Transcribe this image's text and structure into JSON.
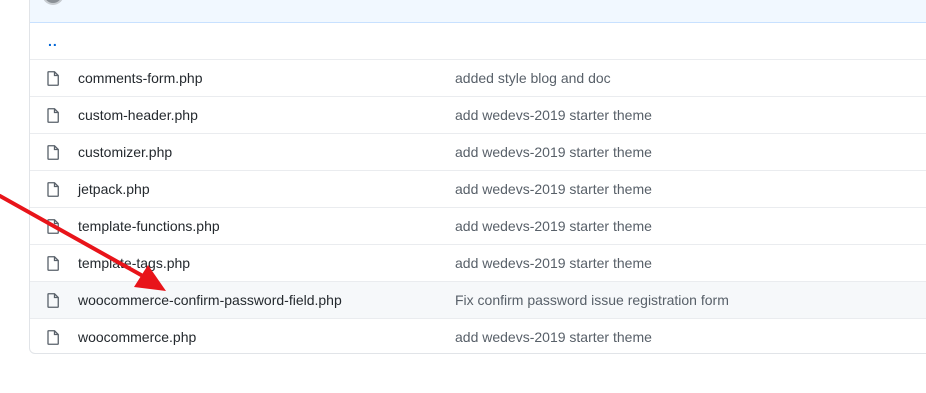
{
  "parent_link": "..",
  "files": [
    {
      "name": "comments-form.php",
      "message": "added style blog and doc"
    },
    {
      "name": "custom-header.php",
      "message": "add wedevs-2019 starter theme"
    },
    {
      "name": "customizer.php",
      "message": "add wedevs-2019 starter theme"
    },
    {
      "name": "jetpack.php",
      "message": "add wedevs-2019 starter theme"
    },
    {
      "name": "template-functions.php",
      "message": "add wedevs-2019 starter theme"
    },
    {
      "name": "template-tags.php",
      "message": "add wedevs-2019 starter theme"
    },
    {
      "name": "woocommerce-confirm-password-field.php",
      "message": "Fix confirm password issue registration form",
      "highlighted": true
    },
    {
      "name": "woocommerce.php",
      "message": "add wedevs-2019 starter theme"
    }
  ],
  "icons": {
    "file": "file-icon",
    "arrow": "annotation-arrow"
  },
  "colors": {
    "link": "#0366d6",
    "annotation": "#e8141a",
    "border": "#e1e4e8"
  }
}
